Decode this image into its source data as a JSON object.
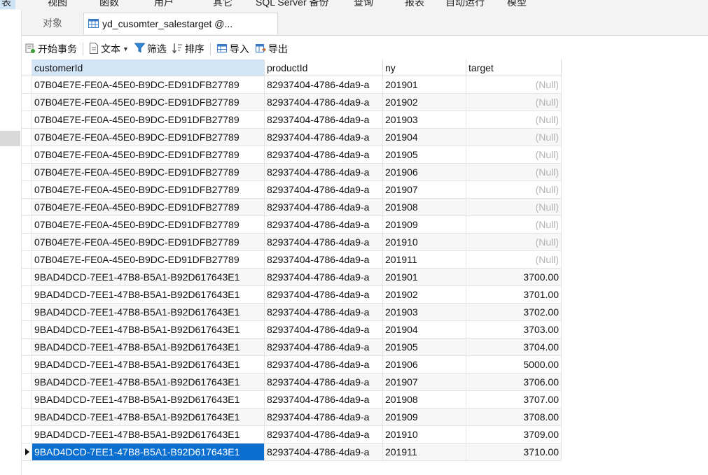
{
  "menu": [
    "表",
    "视图",
    "函数",
    "用户",
    "其它",
    "SQL Server 备份",
    "查询",
    "报表",
    "自动运行",
    "模型"
  ],
  "tabs": {
    "objects": "对象",
    "table": "yd_cusomter_salestarget @..."
  },
  "toolbar": {
    "begin_transaction": "开始事务",
    "text": "文本",
    "filter": "筛选",
    "sort": "排序",
    "import": "导入",
    "export": "导出"
  },
  "grid": {
    "columns": [
      "customerId",
      "productId",
      "ny",
      "target"
    ],
    "rows": [
      [
        "07B04E7E-FE0A-45E0-B9DC-ED91DFB27789",
        "82937404-4786-4da9-a",
        "201901",
        "(Null)"
      ],
      [
        "07B04E7E-FE0A-45E0-B9DC-ED91DFB27789",
        "82937404-4786-4da9-a",
        "201902",
        "(Null)"
      ],
      [
        "07B04E7E-FE0A-45E0-B9DC-ED91DFB27789",
        "82937404-4786-4da9-a",
        "201903",
        "(Null)"
      ],
      [
        "07B04E7E-FE0A-45E0-B9DC-ED91DFB27789",
        "82937404-4786-4da9-a",
        "201904",
        "(Null)"
      ],
      [
        "07B04E7E-FE0A-45E0-B9DC-ED91DFB27789",
        "82937404-4786-4da9-a",
        "201905",
        "(Null)"
      ],
      [
        "07B04E7E-FE0A-45E0-B9DC-ED91DFB27789",
        "82937404-4786-4da9-a",
        "201906",
        "(Null)"
      ],
      [
        "07B04E7E-FE0A-45E0-B9DC-ED91DFB27789",
        "82937404-4786-4da9-a",
        "201907",
        "(Null)"
      ],
      [
        "07B04E7E-FE0A-45E0-B9DC-ED91DFB27789",
        "82937404-4786-4da9-a",
        "201908",
        "(Null)"
      ],
      [
        "07B04E7E-FE0A-45E0-B9DC-ED91DFB27789",
        "82937404-4786-4da9-a",
        "201909",
        "(Null)"
      ],
      [
        "07B04E7E-FE0A-45E0-B9DC-ED91DFB27789",
        "82937404-4786-4da9-a",
        "201910",
        "(Null)"
      ],
      [
        "07B04E7E-FE0A-45E0-B9DC-ED91DFB27789",
        "82937404-4786-4da9-a",
        "201911",
        "(Null)"
      ],
      [
        "9BAD4DCD-7EE1-47B8-B5A1-B92D617643E1",
        "82937404-4786-4da9-a",
        "201901",
        "3700.00"
      ],
      [
        "9BAD4DCD-7EE1-47B8-B5A1-B92D617643E1",
        "82937404-4786-4da9-a",
        "201902",
        "3701.00"
      ],
      [
        "9BAD4DCD-7EE1-47B8-B5A1-B92D617643E1",
        "82937404-4786-4da9-a",
        "201903",
        "3702.00"
      ],
      [
        "9BAD4DCD-7EE1-47B8-B5A1-B92D617643E1",
        "82937404-4786-4da9-a",
        "201904",
        "3703.00"
      ],
      [
        "9BAD4DCD-7EE1-47B8-B5A1-B92D617643E1",
        "82937404-4786-4da9-a",
        "201905",
        "3704.00"
      ],
      [
        "9BAD4DCD-7EE1-47B8-B5A1-B92D617643E1",
        "82937404-4786-4da9-a",
        "201906",
        "5000.00"
      ],
      [
        "9BAD4DCD-7EE1-47B8-B5A1-B92D617643E1",
        "82937404-4786-4da9-a",
        "201907",
        "3706.00"
      ],
      [
        "9BAD4DCD-7EE1-47B8-B5A1-B92D617643E1",
        "82937404-4786-4da9-a",
        "201908",
        "3707.00"
      ],
      [
        "9BAD4DCD-7EE1-47B8-B5A1-B92D617643E1",
        "82937404-4786-4da9-a",
        "201909",
        "3708.00"
      ],
      [
        "9BAD4DCD-7EE1-47B8-B5A1-B92D617643E1",
        "82937404-4786-4da9-a",
        "201910",
        "3709.00"
      ],
      [
        "9BAD4DCD-7EE1-47B8-B5A1-B92D617643E1",
        "82937404-4786-4da9-a",
        "201911",
        "3710.00"
      ]
    ],
    "selected_row": 21,
    "selected_col": 0,
    "null_text": "(Null)"
  },
  "colors": {
    "selection": "#0a6fd1",
    "header_active": "#d3e6f7",
    "null_text": "#b3b3b3",
    "tab_strip": "#f3f3f3"
  },
  "icons": {
    "table_tab": "table-icon",
    "begin_transaction": "transaction-icon",
    "text": "document-icon",
    "filter": "funnel-icon",
    "sort": "sort-icon",
    "import": "import-icon",
    "export": "export-icon"
  }
}
